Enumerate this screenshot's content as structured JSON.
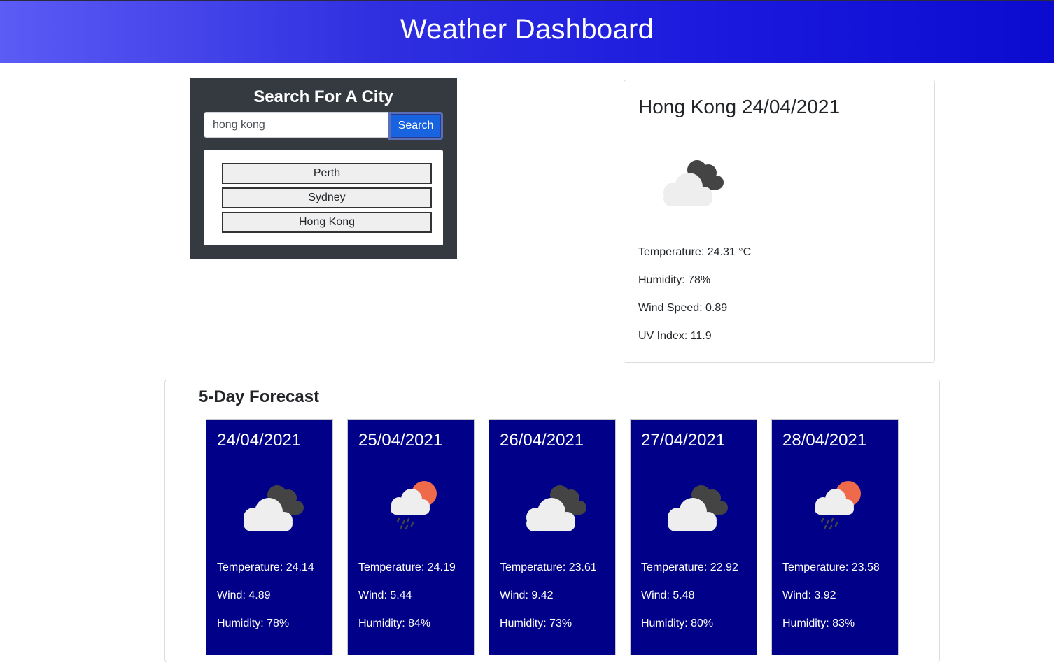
{
  "header": {
    "title": "Weather Dashboard"
  },
  "search": {
    "heading": "Search For A City",
    "input_value": "hong kong",
    "button_label": "Search",
    "history": [
      "Perth",
      "Sydney",
      "Hong Kong"
    ]
  },
  "current": {
    "title": "Hong Kong 24/04/2021",
    "icon": "broken-clouds-icon",
    "temperature": "Temperature: 24.31 °C",
    "humidity": "Humidity: 78%",
    "wind": "Wind Speed: 0.89",
    "uv": "UV Index: 11.9"
  },
  "forecast": {
    "heading": "5-Day Forecast",
    "days": [
      {
        "date": "24/04/2021",
        "icon": "broken-clouds-icon",
        "temp": "Temperature: 24.14",
        "wind": "Wind: 4.89",
        "humidity": "Humidity: 78%"
      },
      {
        "date": "25/04/2021",
        "icon": "light-rain-sun-icon",
        "temp": "Temperature: 24.19",
        "wind": "Wind: 5.44",
        "humidity": "Humidity: 84%"
      },
      {
        "date": "26/04/2021",
        "icon": "broken-clouds-icon",
        "temp": "Temperature: 23.61",
        "wind": "Wind: 9.42",
        "humidity": "Humidity: 73%"
      },
      {
        "date": "27/04/2021",
        "icon": "broken-clouds-icon",
        "temp": "Temperature: 22.92",
        "wind": "Wind: 5.48",
        "humidity": "Humidity: 80%"
      },
      {
        "date": "28/04/2021",
        "icon": "light-rain-sun-icon",
        "temp": "Temperature: 23.58",
        "wind": "Wind: 3.92",
        "humidity": "Humidity: 83%"
      }
    ]
  },
  "colors": {
    "header_start": "#5b5bf5",
    "header_end": "#0b0bd0",
    "search_panel": "#343a40",
    "search_button": "#1863e0",
    "forecast_card": "#000088"
  }
}
